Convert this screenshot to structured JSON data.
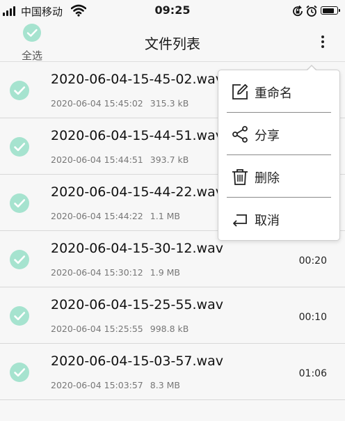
{
  "status_bar": {
    "carrier": "中国移动",
    "time": "09:25"
  },
  "header": {
    "select_all_label": "全选",
    "title": "文件列表"
  },
  "files": [
    {
      "name": "2020-06-04-15-45-02.wav",
      "date": "2020-06-04 15:45:02",
      "size": "315.3 kB",
      "duration": ""
    },
    {
      "name": "2020-06-04-15-44-51.wav",
      "date": "2020-06-04 15:44:51",
      "size": "393.7 kB",
      "duration": ""
    },
    {
      "name": "2020-06-04-15-44-22.wav",
      "date": "2020-06-04 15:44:22",
      "size": "1.1 MB",
      "duration": ""
    },
    {
      "name": "2020-06-04-15-30-12.wav",
      "date": "2020-06-04 15:30:12",
      "size": "1.9 MB",
      "duration": "00:20"
    },
    {
      "name": "2020-06-04-15-25-55.wav",
      "date": "2020-06-04 15:25:55",
      "size": "998.8 kB",
      "duration": "00:10"
    },
    {
      "name": "2020-06-04-15-03-57.wav",
      "date": "2020-06-04 15:03:57",
      "size": "8.3 MB",
      "duration": "01:06"
    }
  ],
  "menu": {
    "items": [
      {
        "label": "重命名",
        "icon": "edit-icon"
      },
      {
        "label": "分享",
        "icon": "share-icon"
      },
      {
        "label": "删除",
        "icon": "trash-icon"
      },
      {
        "label": "取消",
        "icon": "return-icon"
      }
    ]
  },
  "colors": {
    "check_fill": "#a6e3cf",
    "check_mark": "#ffffff",
    "background": "#f7f7f7"
  }
}
